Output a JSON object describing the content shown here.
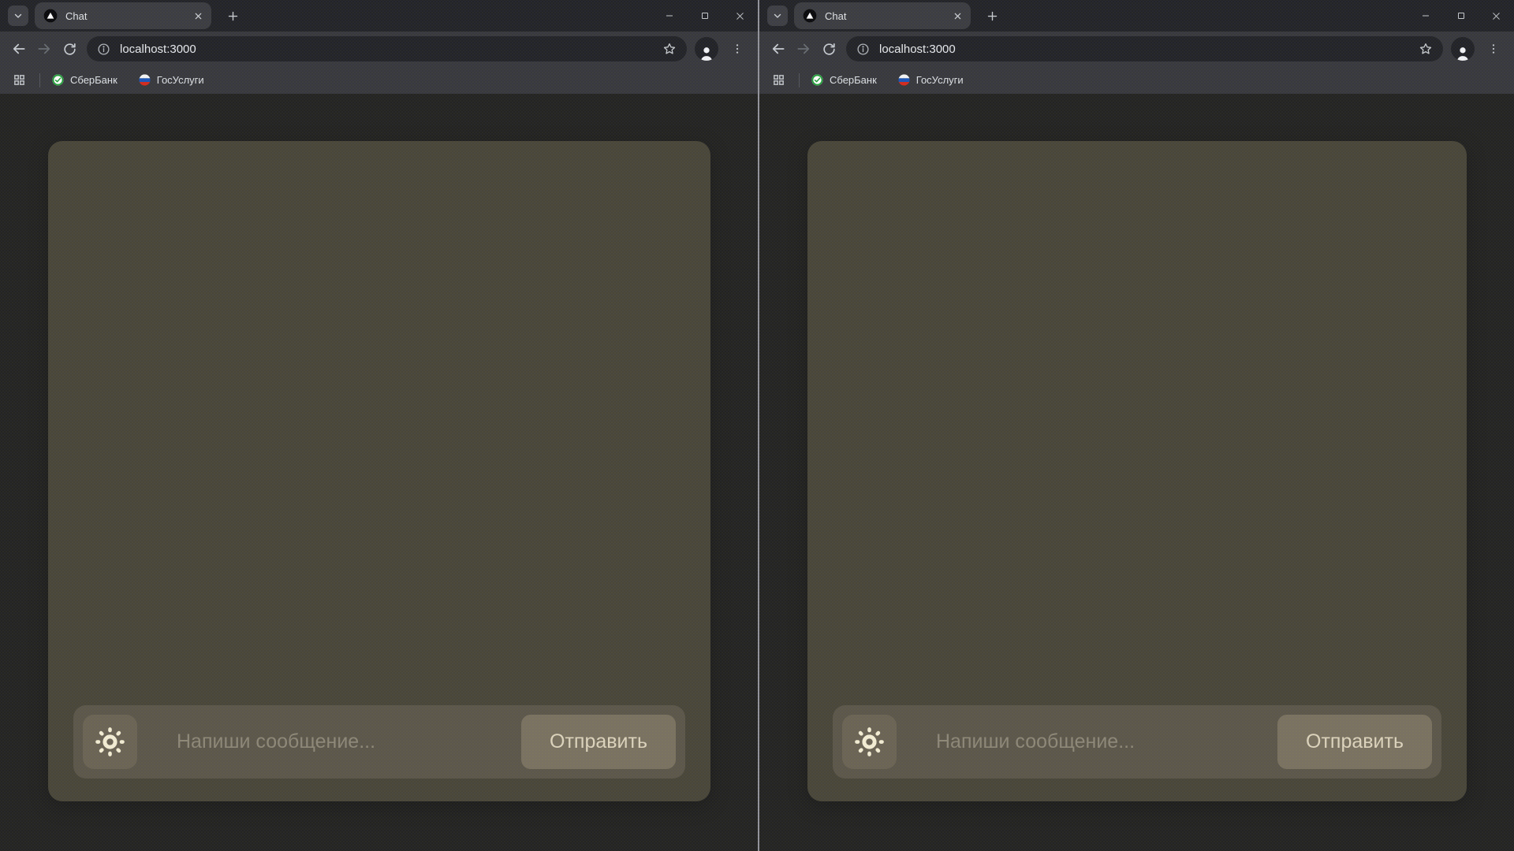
{
  "page": {
    "background": "#242422",
    "window_divider_color": "#94949a"
  },
  "windows": [
    {
      "tab_strip": {
        "tab": {
          "title": "Chat",
          "favicon": "triangle-in-circle-icon"
        },
        "window_controls": {
          "minimize": "minimize",
          "maximize": "maximize",
          "close": "close"
        }
      },
      "toolbar": {
        "omnibox": {
          "url": "localhost:3000"
        }
      },
      "bookmarks_bar": {
        "items": [
          {
            "label": "СберБанк",
            "icon": "sberbank-logo"
          },
          {
            "label": "ГосУслуги",
            "icon": "gosuslugi-logo"
          }
        ]
      },
      "chat": {
        "theme_toggle_icon": "sun-icon",
        "input_value": "",
        "input_placeholder": "Напиши сообщение...",
        "send_button_label": "Отправить"
      }
    },
    {
      "tab_strip": {
        "tab": {
          "title": "Chat",
          "favicon": "triangle-in-circle-icon"
        },
        "window_controls": {
          "minimize": "minimize",
          "maximize": "maximize",
          "close": "close"
        }
      },
      "toolbar": {
        "omnibox": {
          "url": "localhost:3000"
        }
      },
      "bookmarks_bar": {
        "items": [
          {
            "label": "СберБанк",
            "icon": "sberbank-logo"
          },
          {
            "label": "ГосУслуги",
            "icon": "gosuslugi-logo"
          }
        ]
      },
      "chat": {
        "theme_toggle_icon": "sun-icon",
        "input_value": "",
        "input_placeholder": "Напиши сообщение...",
        "send_button_label": "Отправить"
      }
    }
  ],
  "colors": {
    "tab_strip_bg": "#232428",
    "toolbar_bg": "#38393d",
    "tab_bg": "#3c3d41",
    "omnibox_bg": "#232428",
    "chat_card": "#494639",
    "input_bar": "#5c574a",
    "theme_button": "#6b6454",
    "send_button": "#7a7260",
    "sun_icon": "#f3edd3",
    "placeholder_text": "#8e8878",
    "send_label_text": "#ddd4bd"
  }
}
